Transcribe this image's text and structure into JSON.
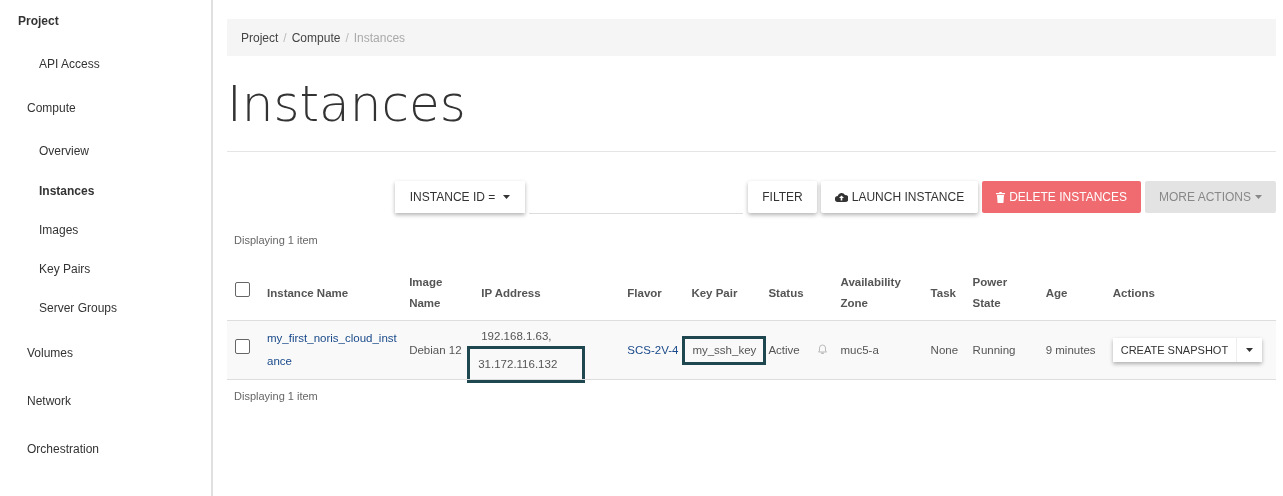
{
  "sidebar": {
    "title": "Project",
    "items": [
      {
        "label": "API Access",
        "kind": "link",
        "selected": false
      },
      {
        "label": "Compute",
        "kind": "group",
        "selected": false
      },
      {
        "label": "Overview",
        "kind": "link",
        "selected": false
      },
      {
        "label": "Instances",
        "kind": "link",
        "selected": true
      },
      {
        "label": "Images",
        "kind": "link",
        "selected": false
      },
      {
        "label": "Key Pairs",
        "kind": "link",
        "selected": false
      },
      {
        "label": "Server Groups",
        "kind": "link",
        "selected": false
      },
      {
        "label": "Volumes",
        "kind": "group",
        "selected": false
      },
      {
        "label": "Network",
        "kind": "group",
        "selected": false
      },
      {
        "label": "Orchestration",
        "kind": "group",
        "selected": false
      }
    ]
  },
  "breadcrumb": [
    "Project",
    "Compute",
    "Instances"
  ],
  "breadcrumb_separators": [
    "/",
    "/"
  ],
  "page_title": "Instances",
  "toolbar": {
    "filter_field": "INSTANCE ID =",
    "buttons": [
      {
        "label": "FILTER",
        "kind": "plain",
        "disabled": false
      },
      {
        "label": "LAUNCH INSTANCE",
        "kind": "launch",
        "disabled": false
      },
      {
        "label": "DELETE INSTANCES",
        "kind": "danger",
        "disabled": false
      },
      {
        "label": "MORE ACTIONS",
        "kind": "menu",
        "disabled": true
      }
    ]
  },
  "count_top": "Displaying 1 item",
  "table": {
    "select_all_checked": false,
    "columns": [
      "Instance Name",
      "Image Name",
      "IP Address",
      "Flavor",
      "Key Pair",
      "Status",
      "Availability Zone",
      "Task",
      "Power State",
      "Age",
      "Actions"
    ],
    "rows": [
      {
        "checked": false,
        "name": "my_first_noris_cloud_instance",
        "image": "Debian 12",
        "ips": [
          {
            "text": "192.168.1.63,",
            "highlighted": false
          },
          {
            "text": "31.172.116.132",
            "highlighted": true
          }
        ],
        "flavor": "SCS-2V-4",
        "key_pair": {
          "text": "my_ssh_key",
          "highlighted": true
        },
        "status": "Active",
        "zone": "muc5-a",
        "task": "None",
        "power": "Running",
        "age": "9 minutes",
        "action": "CREATE SNAPSHOT"
      }
    ]
  },
  "count_bottom": "Displaying 1 item"
}
